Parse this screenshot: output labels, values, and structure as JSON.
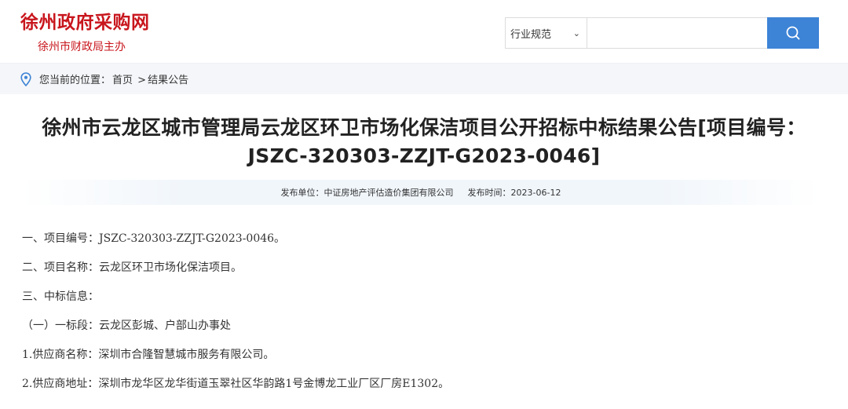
{
  "header": {
    "logo": "徐州政府采购网",
    "subtitle": "徐州市财政局主办",
    "search": {
      "category": "行业规范",
      "placeholder": ""
    }
  },
  "breadcrumb": {
    "prefix": "您当前的位置：",
    "home": "首页",
    "separator": ">",
    "current": "结果公告"
  },
  "article": {
    "title": "徐州市云龙区城市管理局云龙区环卫市场化保洁项目公开招标中标结果公告[项目编号：JSZC-320303-ZZJT-G2023-0046]",
    "publisher_label": "发布单位：",
    "publisher": "中证房地产评估造价集团有限公司",
    "date_label": "发布时间：",
    "date": "2023-06-12",
    "paragraphs": [
      "一、项目编号：JSZC-320303-ZZJT-G2023-0046。",
      "二、项目名称：云龙区环卫市场化保洁项目。",
      "三、中标信息：",
      "（一）一标段：云龙区彭城、户部山办事处",
      "1.供应商名称：深圳市合隆智慧城市服务有限公司。",
      "2.供应商地址：深圳市龙华区龙华街道玉翠社区华韵路1号金博龙工业厂区厂房E1302。"
    ]
  },
  "colors": {
    "brand_red": "#c8161d",
    "search_blue": "#3d83d6",
    "crumb_bg": "#f4f6f9"
  },
  "icons": {
    "search": "search-icon",
    "location": "location-pin-icon",
    "caret": "chevron-down-icon"
  }
}
